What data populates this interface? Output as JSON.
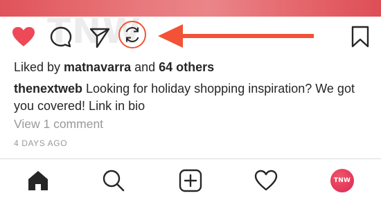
{
  "post": {
    "watermark_text": "TNW",
    "likes": {
      "prefix": "Liked by ",
      "user": "matnavarra",
      "connector": " and ",
      "others": "64 others"
    },
    "caption": {
      "username": "thenextweb",
      "text": " Looking for holiday shopping inspiration? We got you covered! Link in bio"
    },
    "view_comments": "View 1 comment",
    "timestamp": "4 DAYS AGO"
  },
  "actions": {
    "like_icon": "heart-filled-icon",
    "comment_icon": "comment-bubble-icon",
    "share_icon": "paper-plane-icon",
    "repost_icon": "repost-arrows-icon",
    "save_icon": "bookmark-icon",
    "highlight_color": "#f25236",
    "like_color": "#ed4956"
  },
  "tab_bar": {
    "items": [
      {
        "icon": "home-icon"
      },
      {
        "icon": "search-icon"
      },
      {
        "icon": "add-post-icon"
      },
      {
        "icon": "heart-outline-icon"
      },
      {
        "icon": "profile-avatar",
        "avatar_text": "TNW"
      }
    ]
  }
}
